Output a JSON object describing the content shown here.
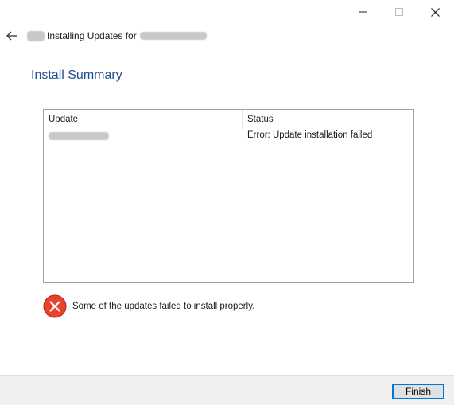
{
  "window": {
    "title_prefix": "Installing Updates for",
    "controls": {
      "minimize_icon": "minimize-icon",
      "maximize_icon": "maximize-icon",
      "close_icon": "close-icon"
    }
  },
  "header": {
    "back_icon": "back-arrow-icon",
    "heading": "Install Summary"
  },
  "updates_table": {
    "columns": [
      "Update",
      "Status"
    ],
    "rows": [
      {
        "update": "",
        "status": "Error: Update installation failed"
      }
    ]
  },
  "result": {
    "icon": "error-icon",
    "message": "Some of the updates failed to install properly."
  },
  "footer": {
    "finish_label": "Finish"
  },
  "colors": {
    "heading": "#1e4e8c",
    "error_red": "#e8412c",
    "focus_border": "#0078d7",
    "footer_bg": "#f0f0f0"
  }
}
